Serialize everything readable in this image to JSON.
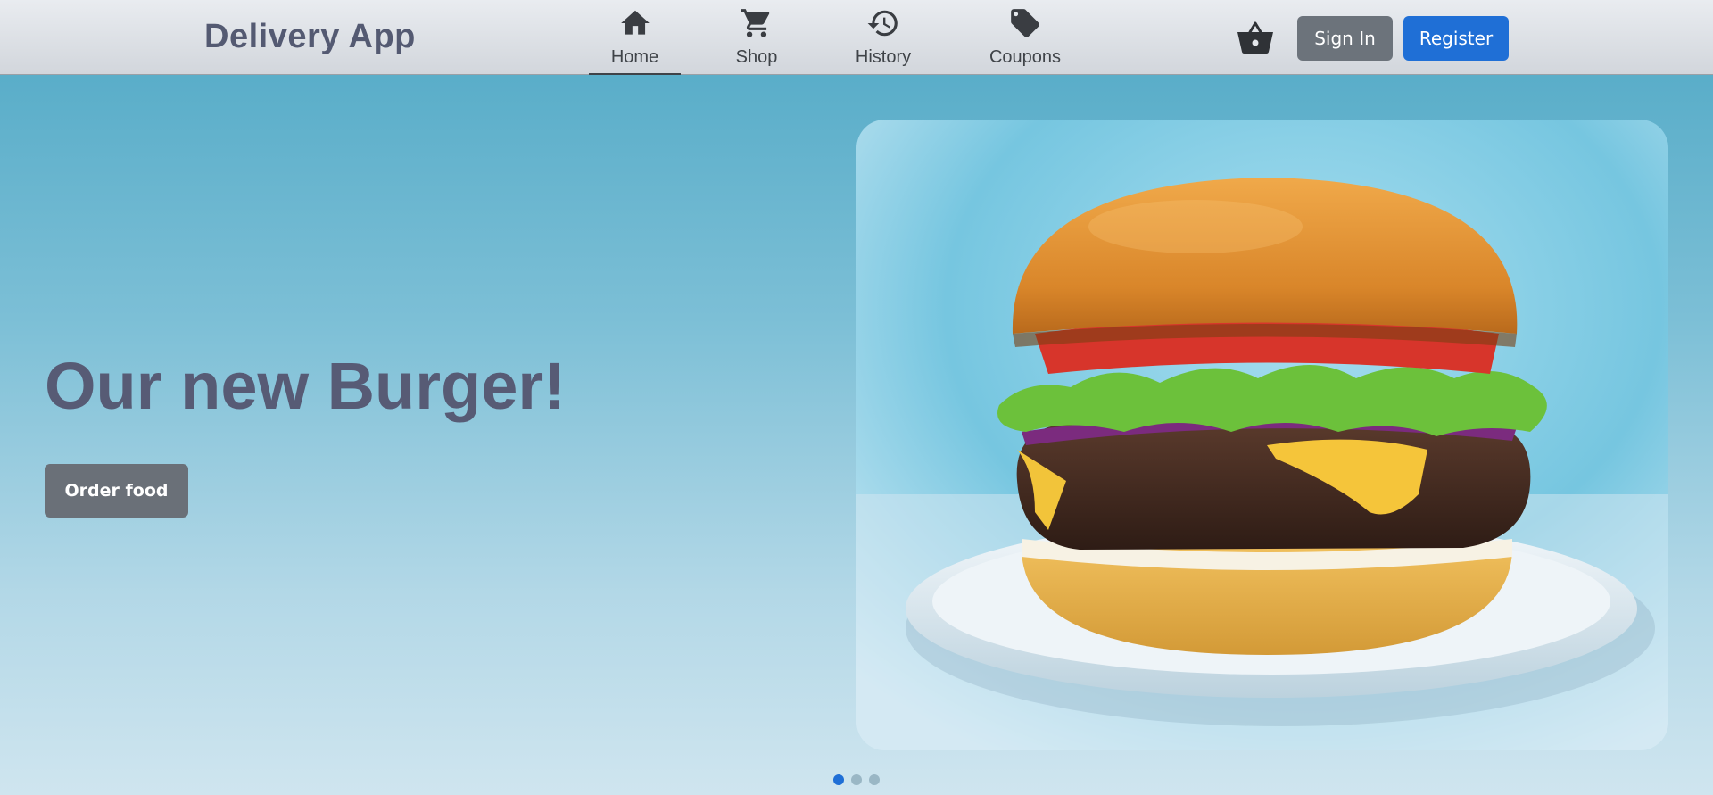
{
  "brand": {
    "name": "Delivery App"
  },
  "nav": {
    "items": [
      {
        "label": "Home",
        "icon": "home-icon",
        "active": true
      },
      {
        "label": "Shop",
        "icon": "cart-icon",
        "active": false
      },
      {
        "label": "History",
        "icon": "history-icon",
        "active": false
      },
      {
        "label": "Coupons",
        "icon": "tag-icon",
        "active": false
      }
    ]
  },
  "header": {
    "basket_icon": "basket-icon",
    "signin_label": "Sign In",
    "register_label": "Register"
  },
  "hero": {
    "title": "Our new Burger!",
    "cta_label": "Order food",
    "image": "burger-image"
  },
  "carousel": {
    "slides": 3,
    "active_index": 0
  },
  "colors": {
    "brand_text": "#545a72",
    "primary": "#1f6fd6",
    "secondary": "#6c737b",
    "background_top": "#4fa8c5",
    "background_bottom": "#cfe5ef"
  }
}
